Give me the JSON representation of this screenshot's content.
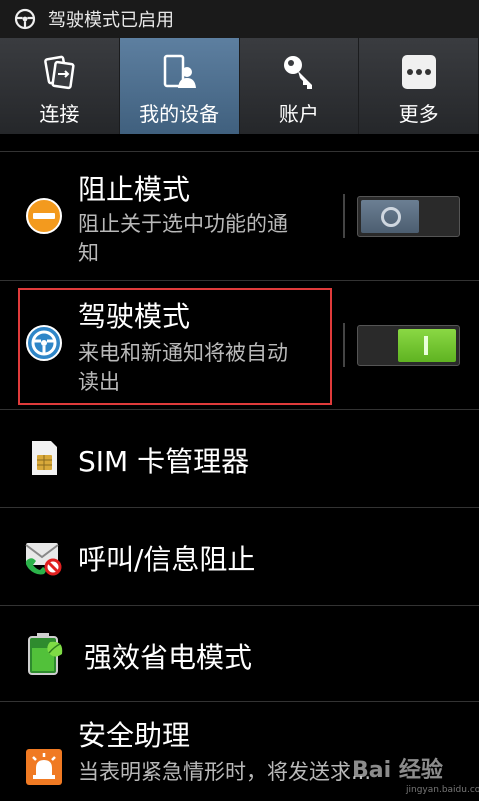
{
  "status_bar": {
    "notification_text": "驾驶模式已启用"
  },
  "tabs": [
    {
      "label": "连接",
      "icon": "connections-icon",
      "active": false
    },
    {
      "label": "我的设备",
      "icon": "my-device-icon",
      "active": true
    },
    {
      "label": "账户",
      "icon": "key-icon",
      "active": false
    },
    {
      "label": "更多",
      "icon": "more-icon",
      "active": false
    }
  ],
  "settings": {
    "blocking_mode": {
      "title": "阻止模式",
      "subtitle_line1": "阻止关于选中功能的通",
      "subtitle_line2": "知",
      "enabled": false
    },
    "driving_mode": {
      "title": "驾驶模式",
      "subtitle_line1": "来电和新通知将被自动",
      "subtitle_line2": "读出",
      "enabled": true
    },
    "sim_manager": {
      "title": "SIM 卡管理器"
    },
    "call_message_blocking": {
      "title": "呼叫/信息阻止"
    },
    "power_saving": {
      "title": "强效省电模式"
    },
    "safety_assistance": {
      "title": "安全助理",
      "subtitle_line1": "当表明紧急情形时，将发送求..."
    }
  },
  "watermark": {
    "text": "Bai 经验",
    "url": "jingyan.baidu.com"
  },
  "colors": {
    "active_tab": "#4f7091",
    "toggle_on": "#76c936",
    "toggle_off": "#5b6e81",
    "highlight": "#e03b3b"
  }
}
